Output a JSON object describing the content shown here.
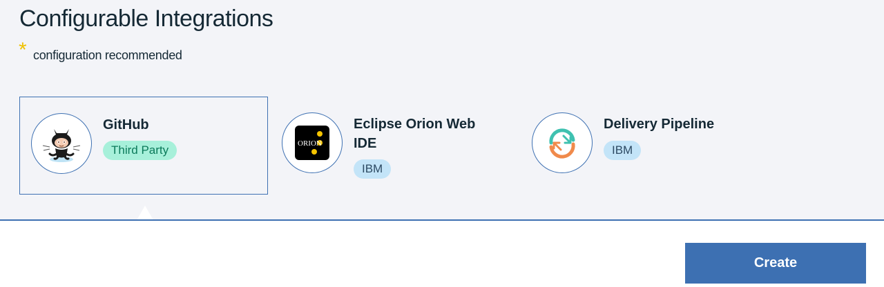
{
  "section": {
    "title": "Configurable Integrations",
    "star": "*",
    "recommended_text": "configuration recommended"
  },
  "tiles": [
    {
      "name": "GitHub",
      "tag": "Third Party",
      "icon": "github-octocat-icon",
      "selected": true
    },
    {
      "name": "Eclipse Orion Web IDE",
      "tag": "IBM",
      "icon": "orion-icon",
      "icon_text": "ORION",
      "selected": false
    },
    {
      "name": "Delivery Pipeline",
      "tag": "IBM",
      "icon": "delivery-pipeline-icon",
      "selected": false
    }
  ],
  "actions": {
    "create_label": "Create"
  },
  "colors": {
    "accent": "#3d70b2",
    "background": "#f3f4f8",
    "star": "#efc100",
    "third_party_tag": "#a7f0da",
    "ibm_tag": "#c3e4f8"
  }
}
